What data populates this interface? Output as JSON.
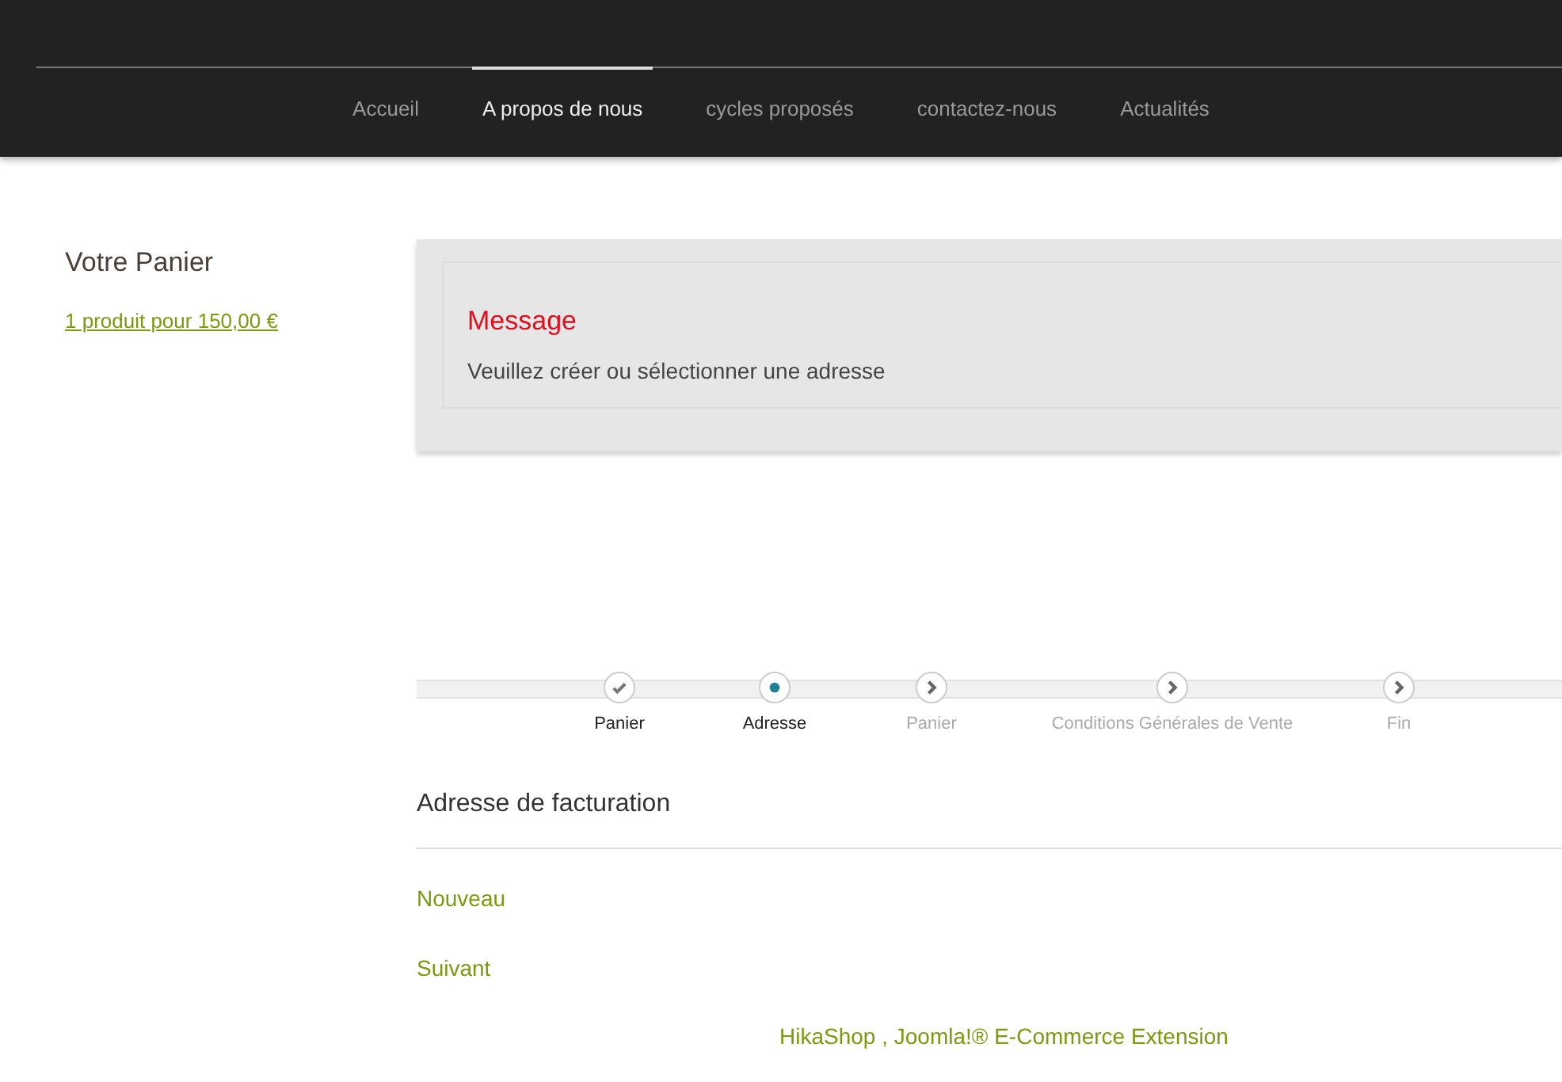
{
  "nav": {
    "items": [
      {
        "label": "Accueil",
        "selected": false
      },
      {
        "label": "A propos de nous",
        "selected": true
      },
      {
        "label": "cycles proposés",
        "selected": false
      },
      {
        "label": "contactez-nous",
        "selected": false
      },
      {
        "label": "Actualités",
        "selected": false
      }
    ]
  },
  "sidebar": {
    "title": "Votre Panier",
    "cart_link": "1 produit pour 150,00 €"
  },
  "message": {
    "title": "Message",
    "text": "Veuillez créer ou sélectionner une adresse"
  },
  "steps": [
    {
      "label": "Panier",
      "kind": "done"
    },
    {
      "label": "Adresse",
      "kind": "current"
    },
    {
      "label": "Panier",
      "kind": "todo"
    },
    {
      "label": "Conditions Générales de Vente",
      "kind": "todo"
    },
    {
      "label": "Fin",
      "kind": "todo"
    }
  ],
  "billing": {
    "title": "Adresse de facturation",
    "new_link": "Nouveau",
    "next_link": "Suivant"
  },
  "footer": {
    "credit": "HikaShop , Joomla!® E-Commerce Extension"
  }
}
